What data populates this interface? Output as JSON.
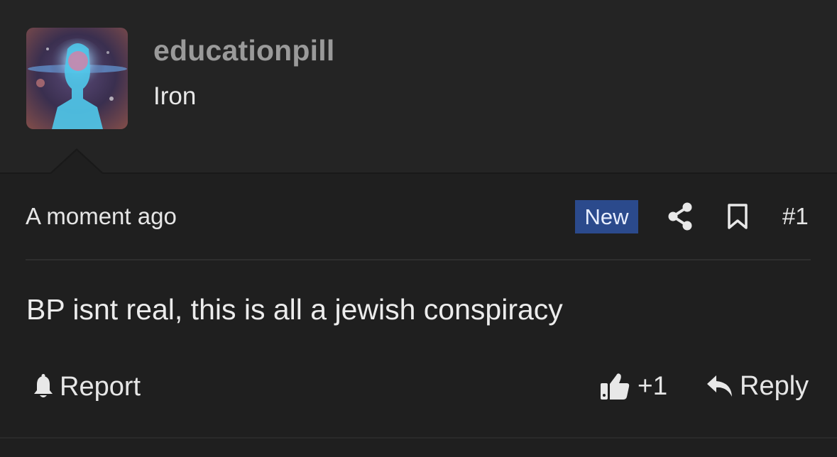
{
  "user": {
    "username": "educationpill",
    "title": "Iron"
  },
  "post": {
    "timestamp": "A moment ago",
    "badge": "New",
    "number": "#1",
    "body": "BP isnt real, this is all a jewish conspiracy"
  },
  "actions": {
    "report_label": "Report",
    "like_count": "+1",
    "reply_label": "Reply"
  },
  "icons": {
    "share": "share-icon",
    "bookmark": "bookmark-icon",
    "report": "bell-icon",
    "like": "thumbs-up-icon",
    "reply": "reply-arrow-icon"
  },
  "colors": {
    "background": "#1f1f1f",
    "header_background": "#242424",
    "badge_background": "#2b4a8c",
    "username": "#9a9a9a",
    "text": "#e6e6e6"
  }
}
